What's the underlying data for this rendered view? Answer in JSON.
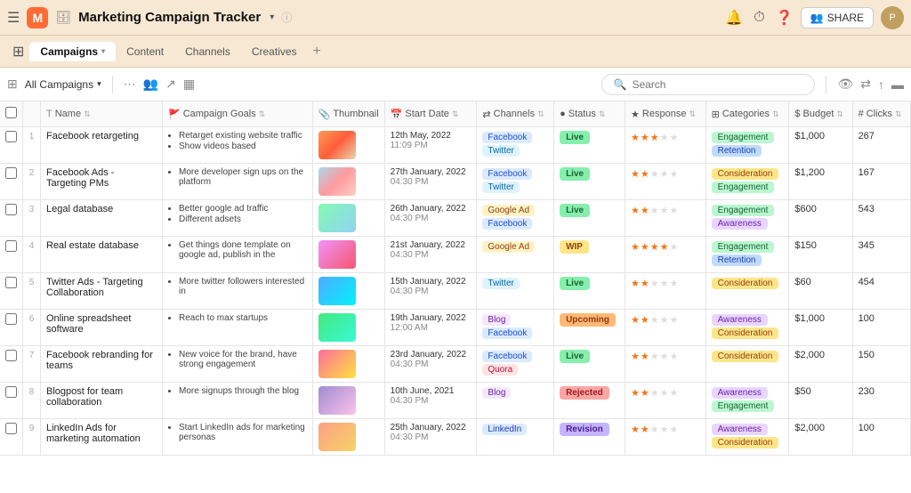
{
  "app": {
    "logo_letter": "M",
    "title": "Marketing Campaign Tracker",
    "info_tooltip": "More info"
  },
  "topnav": {
    "share_label": "SHARE"
  },
  "tabs": [
    {
      "id": "campaigns",
      "label": "Campaigns",
      "active": true,
      "has_chevron": true
    },
    {
      "id": "content",
      "label": "Content",
      "active": false,
      "has_chevron": false
    },
    {
      "id": "channels",
      "label": "Channels",
      "active": false,
      "has_chevron": false
    },
    {
      "id": "creatives",
      "label": "Creatives",
      "active": false,
      "has_chevron": false
    }
  ],
  "toolbar": {
    "view_label": "All Campaigns",
    "search_placeholder": "Search"
  },
  "columns": [
    {
      "id": "num",
      "label": "#",
      "icon": ""
    },
    {
      "id": "name",
      "label": "Name",
      "icon": "text"
    },
    {
      "id": "goals",
      "label": "Campaign Goals",
      "icon": "flag"
    },
    {
      "id": "thumbnail",
      "label": "Thumbnail",
      "icon": "image"
    },
    {
      "id": "start_date",
      "label": "Start Date",
      "icon": "calendar"
    },
    {
      "id": "channels",
      "label": "Channels",
      "icon": "wifi"
    },
    {
      "id": "status",
      "label": "Status",
      "icon": "circle"
    },
    {
      "id": "response",
      "label": "Response",
      "icon": "star"
    },
    {
      "id": "categories",
      "label": "Categories",
      "icon": "grid"
    },
    {
      "id": "budget",
      "label": "Budget",
      "icon": "dollar"
    },
    {
      "id": "clicks",
      "label": "Clicks",
      "icon": "hash"
    }
  ],
  "rows": [
    {
      "num": 1,
      "name": "Facebook retargeting",
      "goals": [
        "Retarget existing website traffic",
        "Show videos based"
      ],
      "thumb_class": "t1",
      "start_date": "12th May, 2022",
      "start_time": "11:09 PM",
      "channels": [
        "Facebook",
        "Twitter"
      ],
      "channel_classes": [
        "ch-facebook",
        "ch-twitter"
      ],
      "status": "Live",
      "status_class": "st-live",
      "response_stars": 3,
      "categories": [
        "Engagement",
        "Retention"
      ],
      "cat_classes": [
        "cat-engagement",
        "cat-retention"
      ],
      "budget": "$1,000",
      "clicks": "267"
    },
    {
      "num": 2,
      "name": "Facebook Ads - Targeting PMs",
      "goals": [
        "More developer sign ups on the platform"
      ],
      "thumb_class": "t2",
      "start_date": "27th January, 2022",
      "start_time": "04:30 PM",
      "channels": [
        "Facebook",
        "Twitter"
      ],
      "channel_classes": [
        "ch-facebook",
        "ch-twitter"
      ],
      "status": "Live",
      "status_class": "st-live",
      "response_stars": 2,
      "categories": [
        "Consideration",
        "Engagement"
      ],
      "cat_classes": [
        "cat-consideration",
        "cat-engagement"
      ],
      "budget": "$1,200",
      "clicks": "167"
    },
    {
      "num": 3,
      "name": "Legal database",
      "goals": [
        "Better google ad traffic",
        "Different adsets"
      ],
      "thumb_class": "t3",
      "start_date": "26th January, 2022",
      "start_time": "04:30 PM",
      "channels": [
        "Google Ad",
        "Facebook"
      ],
      "channel_classes": [
        "ch-google",
        "ch-facebook"
      ],
      "status": "Live",
      "status_class": "st-live",
      "response_stars": 2,
      "categories": [
        "Engagement",
        "Awareness"
      ],
      "cat_classes": [
        "cat-engagement",
        "cat-awareness"
      ],
      "budget": "$600",
      "clicks": "543"
    },
    {
      "num": 4,
      "name": "Real estate database",
      "goals": [
        "Get things done template on google ad, publish in the"
      ],
      "thumb_class": "t4",
      "start_date": "21st January, 2022",
      "start_time": "04:30 PM",
      "channels": [
        "Google Ad"
      ],
      "channel_classes": [
        "ch-google"
      ],
      "status": "WIP",
      "status_class": "st-wip",
      "response_stars": 4,
      "categories": [
        "Engagement",
        "Retention"
      ],
      "cat_classes": [
        "cat-engagement",
        "cat-retention"
      ],
      "budget": "$150",
      "clicks": "345"
    },
    {
      "num": 5,
      "name": "Twitter Ads - Targeting Collaboration",
      "goals": [
        "More twitter followers interested in"
      ],
      "thumb_class": "t5",
      "start_date": "15th January, 2022",
      "start_time": "04:30 PM",
      "channels": [
        "Twitter"
      ],
      "channel_classes": [
        "ch-twitter"
      ],
      "status": "Live",
      "status_class": "st-live",
      "response_stars": 2,
      "categories": [
        "Consideration"
      ],
      "cat_classes": [
        "cat-consideration"
      ],
      "budget": "$60",
      "clicks": "454"
    },
    {
      "num": 6,
      "name": "Online spreadsheet software",
      "goals": [
        "Reach to max startups"
      ],
      "thumb_class": "t6",
      "start_date": "19th January, 2022",
      "start_time": "12:00 AM",
      "channels": [
        "Blog",
        "Facebook"
      ],
      "channel_classes": [
        "ch-blog",
        "ch-facebook"
      ],
      "status": "Upcoming",
      "status_class": "st-upcoming",
      "response_stars": 2,
      "categories": [
        "Awareness",
        "Consideration"
      ],
      "cat_classes": [
        "cat-awareness",
        "cat-consideration"
      ],
      "budget": "$1,000",
      "clicks": "100"
    },
    {
      "num": 7,
      "name": "Facebook rebranding for teams",
      "goals": [
        "New voice for the brand, have strong engagement"
      ],
      "thumb_class": "t7",
      "start_date": "23rd January, 2022",
      "start_time": "04:30 PM",
      "channels": [
        "Facebook",
        "Quora"
      ],
      "channel_classes": [
        "ch-facebook",
        "ch-quora"
      ],
      "status": "Live",
      "status_class": "st-live",
      "response_stars": 2,
      "categories": [
        "Consideration"
      ],
      "cat_classes": [
        "cat-consideration"
      ],
      "budget": "$2,000",
      "clicks": "150"
    },
    {
      "num": 8,
      "name": "Blogpost for team collaboration",
      "goals": [
        "More signups through the blog"
      ],
      "thumb_class": "t8",
      "start_date": "10th June, 2021",
      "start_time": "04:30 PM",
      "channels": [
        "Blog"
      ],
      "channel_classes": [
        "ch-blog"
      ],
      "status": "Rejected",
      "status_class": "st-rejected",
      "response_stars": 2,
      "categories": [
        "Awareness",
        "Engagement"
      ],
      "cat_classes": [
        "cat-awareness",
        "cat-engagement"
      ],
      "budget": "$50",
      "clicks": "230"
    },
    {
      "num": 9,
      "name": "LinkedIn Ads for marketing automation",
      "goals": [
        "Start LinkedIn ads for marketing personas"
      ],
      "thumb_class": "t9",
      "start_date": "25th January, 2022",
      "start_time": "04:30 PM",
      "channels": [
        "LinkedIn"
      ],
      "channel_classes": [
        "ch-linkedin"
      ],
      "status": "Revision",
      "status_class": "st-revision",
      "response_stars": 2,
      "categories": [
        "Awareness",
        "Consideration"
      ],
      "cat_classes": [
        "cat-awareness",
        "cat-consideration"
      ],
      "budget": "$2,000",
      "clicks": "100"
    }
  ]
}
